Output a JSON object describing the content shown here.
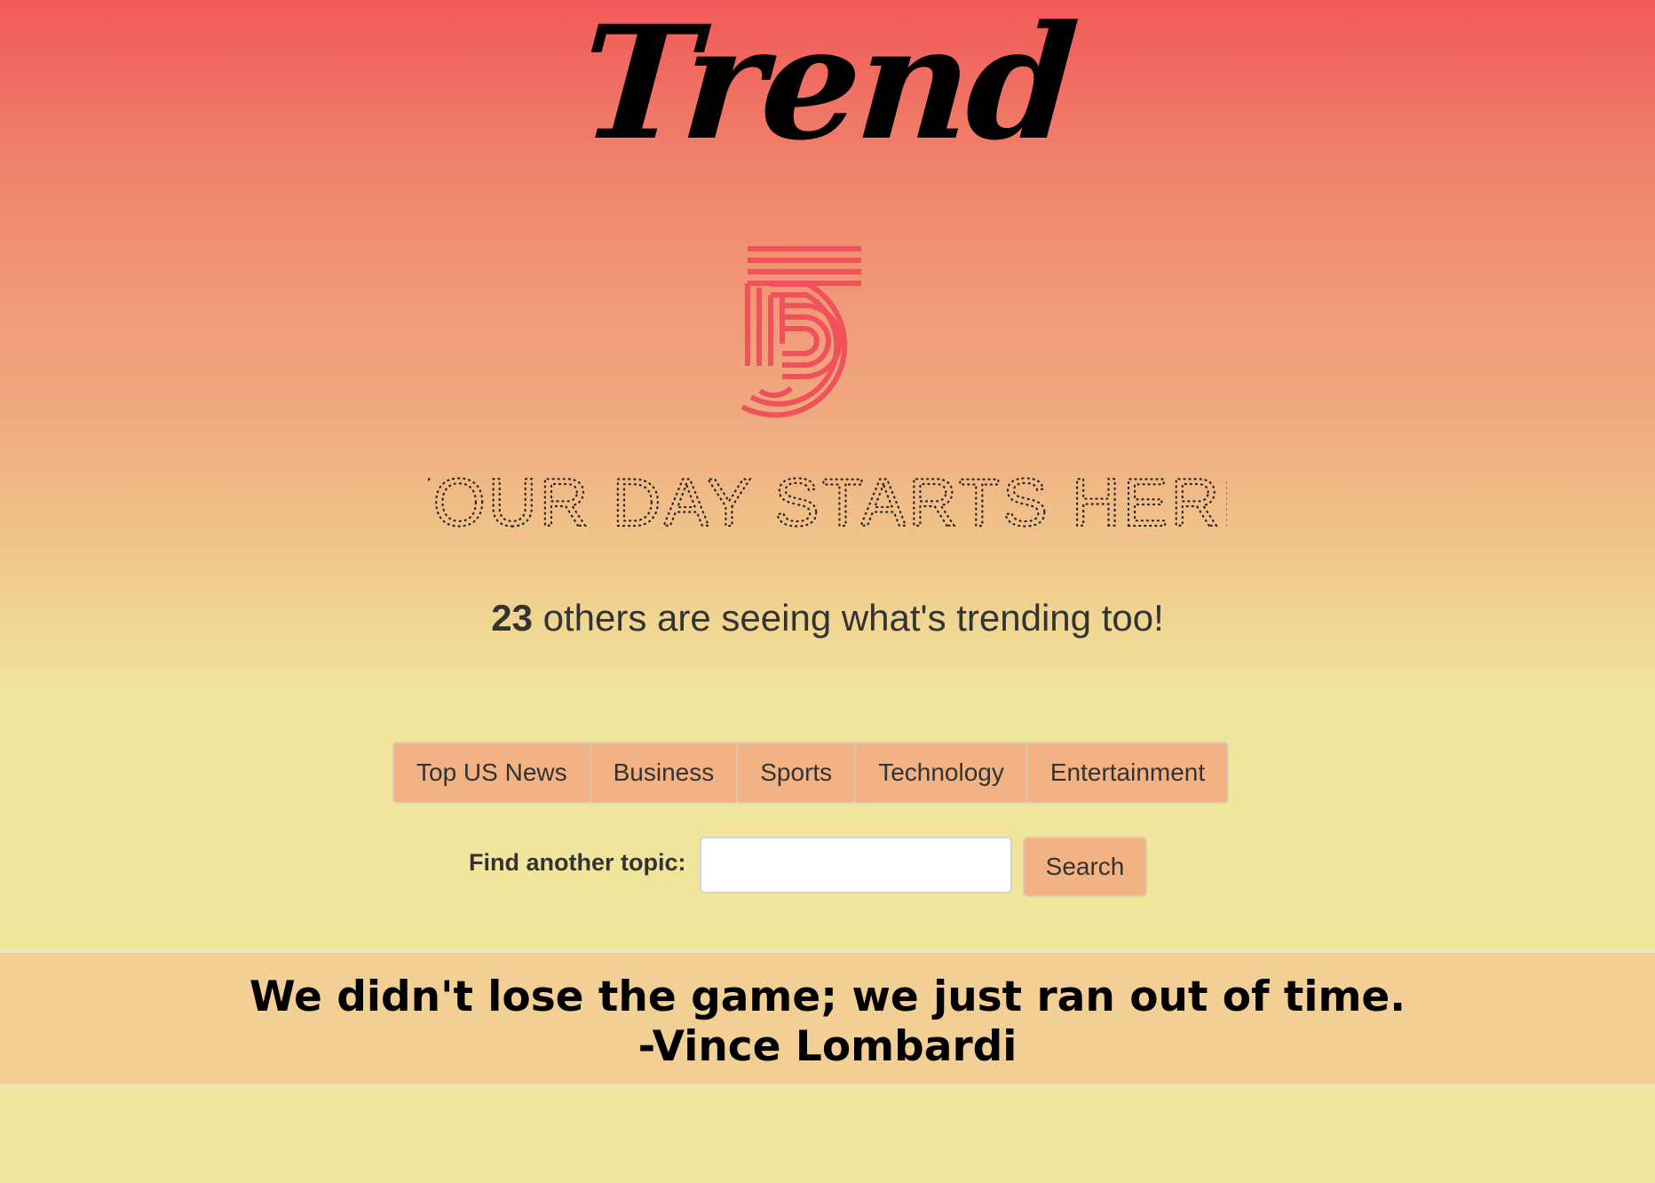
{
  "brand": {
    "logo_text": "Trend",
    "mark_digit": "5",
    "tagline": "YOUR DAY STARTS HERE"
  },
  "counter": {
    "count": "23",
    "text": " others are seeing what's trending too!"
  },
  "nav": {
    "tabs": [
      {
        "label": "Top US News"
      },
      {
        "label": "Business"
      },
      {
        "label": "Sports"
      },
      {
        "label": "Technology"
      },
      {
        "label": "Entertainment"
      }
    ]
  },
  "search": {
    "label": "Find another topic:",
    "value": "",
    "button_label": "Search"
  },
  "quote": {
    "text": "We didn't lose the game; we just ran out of time.",
    "author": "-Vince Lombardi"
  },
  "colors": {
    "gradient_top": "#f15959",
    "gradient_bottom": "#f0e59b",
    "accent_red": "#f0515a",
    "button_bg": "#f2b283",
    "quote_band": "#f2cf95"
  }
}
